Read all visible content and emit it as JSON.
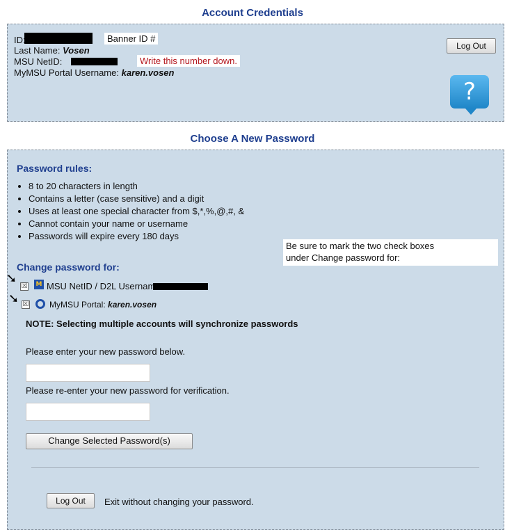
{
  "credentials": {
    "title": "Account Credentials",
    "id_label": "ID:",
    "banner_callout": "Banner ID #",
    "last_name_label": "Last Name:",
    "last_name_value": "Vosen",
    "netid_label": "MSU NetID:",
    "netid_callout": "Write this number down.",
    "portal_label": "MyMSU Portal Username:",
    "portal_value": "karen.vosen",
    "logout_label": "Log Out",
    "help_glyph": "?"
  },
  "password": {
    "title": "Choose A New Password",
    "rules_heading": "Password rules:",
    "rules": [
      "8 to 20 characters in length",
      "Contains a letter (case sensitive) and a digit",
      "Uses at least one special character from $,*,%,@,#, &",
      "Cannot contain your name or username",
      "Passwords will expire every 180 days"
    ],
    "callout_line1": "Be sure to mark the two check boxes",
    "callout_line2": "under Change password for:",
    "change_heading": "Change password for:",
    "account1_label": "MSU NetID / D2L Username:",
    "account2_label": "MyMSU Portal:",
    "account2_value": "karen.vosen",
    "note": "NOTE: Selecting multiple accounts will synchronize passwords",
    "enter_prompt": "Please enter your new password below.",
    "reenter_prompt": "Please re-enter your new password for verification.",
    "submit_label": "Change Selected Password(s)",
    "logout_label": "Log Out",
    "exit_text": "Exit without changing your password.",
    "check_glyph": "☒",
    "arrow_glyph": "➘",
    "msu_icon_glyph": "M"
  }
}
